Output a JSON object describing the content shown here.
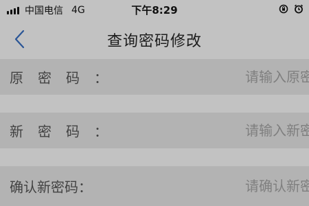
{
  "status_bar": {
    "carrier": "中国电信",
    "network": "4G",
    "time": "下午8:29"
  },
  "nav": {
    "title": "查询密码修改"
  },
  "form": {
    "rows": [
      {
        "label_chars": [
          "原",
          "密",
          "码",
          "："
        ],
        "placeholder": "请输入原密码"
      },
      {
        "label_chars": [
          "新",
          "密",
          "码",
          "："
        ],
        "placeholder": "请输入新密码"
      },
      {
        "label": "确认新密码：",
        "placeholder": "请确认新密码"
      }
    ]
  },
  "colors": {
    "background": "#d9d9d9",
    "row_background": "#c8c8c8",
    "accent": "#2f5fa8"
  },
  "icons": [
    "signal-icon",
    "back-arrow-icon",
    "screen-rotation-lock-icon",
    "alarm-icon"
  ]
}
